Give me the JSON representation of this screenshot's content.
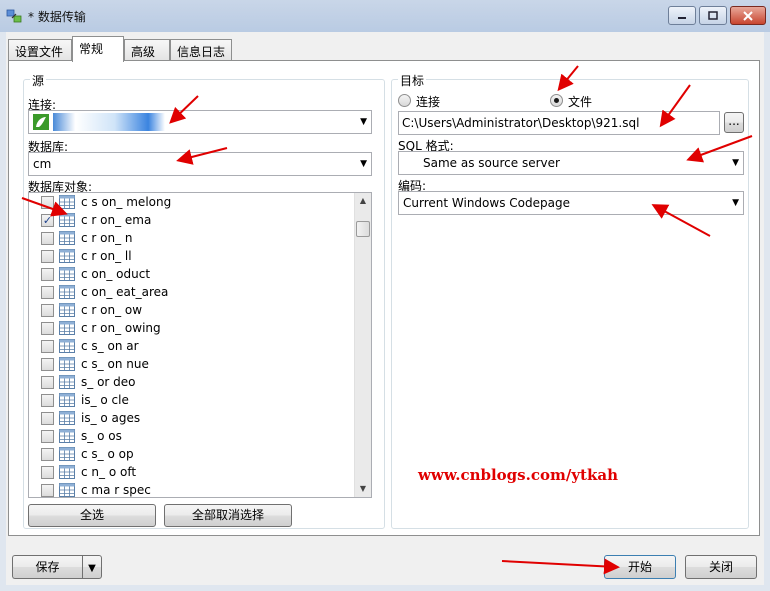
{
  "window": {
    "title": "* 数据传输",
    "controls": {
      "minimize": "▭",
      "maximize": "▭",
      "close": "✕"
    }
  },
  "tabs": [
    {
      "label": "设置文件",
      "active": false
    },
    {
      "label": "常规",
      "active": true
    },
    {
      "label": "高级",
      "active": false
    },
    {
      "label": "信息日志",
      "active": false
    }
  ],
  "source": {
    "group_title": "源",
    "connection_label": "连接:",
    "connection_value": "",
    "database_label": "数据库:",
    "database_value": "cm",
    "objects_label": "数据库对象:",
    "objects": [
      {
        "name": "c   s       on_   melong",
        "checked": false
      },
      {
        "name": "c   r       on_   ema",
        "checked": true
      },
      {
        "name": "c    r      on_   n",
        "checked": false
      },
      {
        "name": "c   r       on_   ll",
        "checked": false
      },
      {
        "name": "c           on_   oduct",
        "checked": false
      },
      {
        "name": "c           on_   eat_area",
        "checked": false
      },
      {
        "name": "c   r       on_   ow",
        "checked": false
      },
      {
        "name": "c   r       on_   owing",
        "checked": false
      },
      {
        "name": "c   s_      on    ar",
        "checked": false
      },
      {
        "name": "c   s_      on    nue",
        "checked": false
      },
      {
        "name": "    s_      or    deo",
        "checked": false
      },
      {
        "name": "    is_     o     cle",
        "checked": false
      },
      {
        "name": "    is_     o     ages",
        "checked": false
      },
      {
        "name": "    s_      o     os",
        "checked": false
      },
      {
        "name": "c   s_      o     op",
        "checked": false
      },
      {
        "name": "c   n_      o     oft",
        "checked": false
      },
      {
        "name": "c   ma      r     spec",
        "checked": false
      }
    ],
    "select_all": "全选",
    "deselect_all": "全部取消选择"
  },
  "target": {
    "group_title": "目标",
    "radio_connection": "连接",
    "radio_file": "文件",
    "selected": "file",
    "file_path": "C:\\Users\\Administrator\\Desktop\\921.sql",
    "browse_label": "...",
    "sql_format_label": "SQL 格式:",
    "sql_format_value": "Same as source server",
    "encoding_label": "编码:",
    "encoding_value": "Current Windows Codepage"
  },
  "watermark": "www.cnblogs.com/ytkah",
  "footer": {
    "save": "保存",
    "start": "开始",
    "close": "关闭"
  },
  "colors": {
    "annotation_arrow": "#e00000",
    "watermark": "#e00000",
    "connection_icon": "#3a9a2a"
  },
  "icons": {
    "app": "transfer-icon",
    "connection": "mysql-connection-icon",
    "table": "table-icon",
    "dropdown": "chevron-down-icon",
    "split": "split-arrow-icon"
  }
}
